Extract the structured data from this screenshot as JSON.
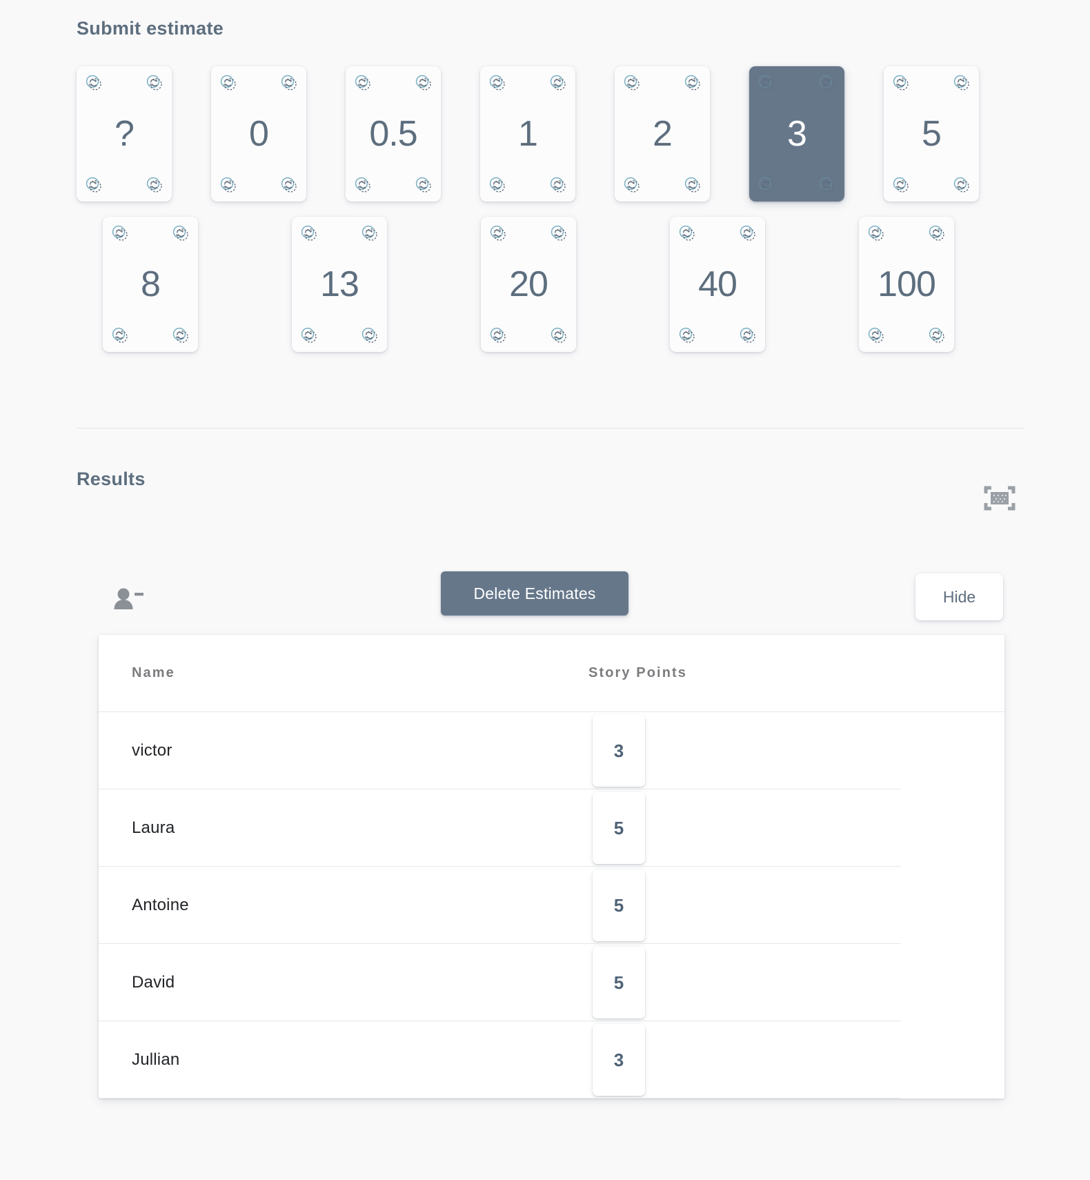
{
  "submit_section": {
    "title": "Submit estimate",
    "selected_value": "3",
    "cards_row1": [
      {
        "label": "?",
        "selected": false
      },
      {
        "label": "0",
        "selected": false
      },
      {
        "label": "0.5",
        "selected": false
      },
      {
        "label": "1",
        "selected": false
      },
      {
        "label": "2",
        "selected": false
      },
      {
        "label": "3",
        "selected": true
      },
      {
        "label": "5",
        "selected": false
      }
    ],
    "cards_row2": [
      {
        "label": "8",
        "selected": false
      },
      {
        "label": "13",
        "selected": false
      },
      {
        "label": "20",
        "selected": false
      },
      {
        "label": "40",
        "selected": false
      },
      {
        "label": "100",
        "selected": false
      }
    ],
    "card_corner_icon": "poker-chip-icon"
  },
  "results_section": {
    "title": "Results",
    "scan_icon": "fullscreen-scan-icon",
    "person_remove_icon": "person-remove-icon",
    "delete_button_label": "Delete Estimates",
    "hide_button_label": "Hide",
    "table": {
      "columns": [
        "Name",
        "Story Points"
      ],
      "rows": [
        {
          "name": "victor",
          "points": "3"
        },
        {
          "name": "Laura",
          "points": "5"
        },
        {
          "name": "Antoine",
          "points": "5"
        },
        {
          "name": "David",
          "points": "5"
        },
        {
          "name": "Jullian",
          "points": "3"
        }
      ]
    }
  },
  "colors": {
    "page_background": "#f9f9fa",
    "heading_text": "#5d6e7e",
    "accent_slate": "#66778a",
    "card_face": "#fcfcfd",
    "table_background": "#ffffff",
    "row_text": "#222428",
    "column_header_text": "#7c7c80",
    "divider": "#e6e7e9",
    "corner_icon_tint": "#6fa8bd"
  }
}
